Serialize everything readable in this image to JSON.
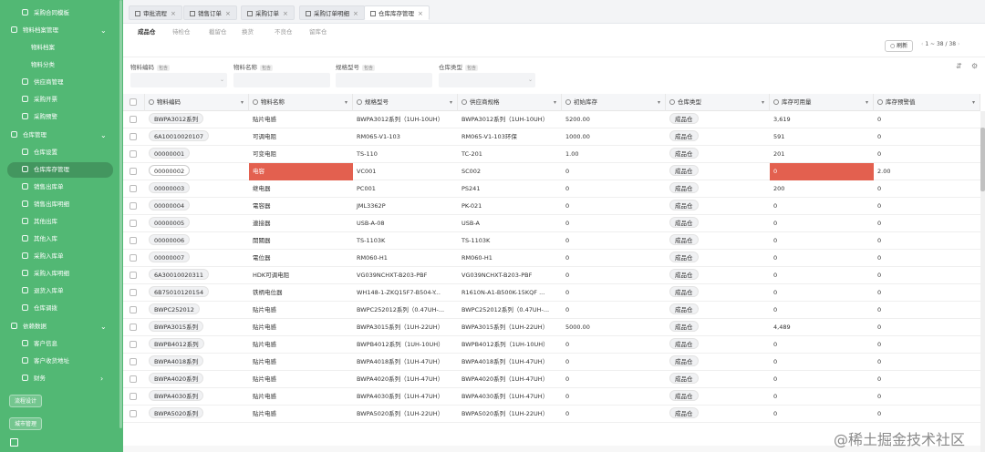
{
  "sidebar": {
    "items": [
      {
        "label": "采购合同模板",
        "level": 1,
        "chevron": false
      },
      {
        "label": "物料档案管理",
        "level": 0,
        "chevron": true
      },
      {
        "label": "物料档案",
        "level": 2,
        "chevron": false
      },
      {
        "label": "物料分类",
        "level": 2,
        "chevron": false
      },
      {
        "label": "供应商管理",
        "level": 1,
        "chevron": false
      },
      {
        "label": "采购开票",
        "level": 1,
        "chevron": false
      },
      {
        "label": "采购预警",
        "level": 1,
        "chevron": false
      },
      {
        "label": "仓库管理",
        "level": 0,
        "chevron": true
      },
      {
        "label": "仓库设置",
        "level": 1,
        "chevron": false
      },
      {
        "label": "仓库库存管理",
        "level": 1,
        "chevron": false,
        "active": true
      },
      {
        "label": "销售出库单",
        "level": 1,
        "chevron": false
      },
      {
        "label": "销售出库明细",
        "level": 1,
        "chevron": false
      },
      {
        "label": "其他出库",
        "level": 1,
        "chevron": false
      },
      {
        "label": "其他入库",
        "level": 1,
        "chevron": false
      },
      {
        "label": "采购入库单",
        "level": 1,
        "chevron": false
      },
      {
        "label": "采购入库明细",
        "level": 1,
        "chevron": false
      },
      {
        "label": "退货入库单",
        "level": 1,
        "chevron": false
      },
      {
        "label": "仓库调拨",
        "level": 1,
        "chevron": false
      },
      {
        "label": "依赖数据",
        "level": 0,
        "chevron": true
      },
      {
        "label": "客户信息",
        "level": 1,
        "chevron": false
      },
      {
        "label": "客户收货地址",
        "level": 1,
        "chevron": false
      },
      {
        "label": "财务",
        "level": 1,
        "chevron": "right"
      }
    ],
    "buttons": [
      "流程设计",
      "城市管理"
    ]
  },
  "tabs": [
    {
      "label": "审批流程",
      "active": false
    },
    {
      "label": "销售订单",
      "active": false
    },
    {
      "label": "采购订单",
      "active": false
    },
    {
      "label": "采购订单明细",
      "active": false
    },
    {
      "label": "仓库库存管理",
      "active": true
    }
  ],
  "subtabs": [
    "成品仓",
    "待检仓",
    "截留仓",
    "换货",
    "不良仓",
    "留库仓"
  ],
  "toolbar": {
    "refresh_label": "刷新",
    "pager": "1 ~ 38 / 38"
  },
  "filters": [
    {
      "label": "物料编码",
      "tag": "包含"
    },
    {
      "label": "物料名称",
      "tag": "包含"
    },
    {
      "label": "规格型号",
      "tag": "包含"
    },
    {
      "label": "仓库类型",
      "tag": "包含"
    }
  ],
  "table": {
    "columns": [
      "物料编码",
      "物料名称",
      "规格型号",
      "供应商规格",
      "初始库存",
      "仓库类型",
      "库存可用量",
      "库存预警值"
    ],
    "rows": [
      {
        "code": "BWPA3012系列",
        "name": "贴片电感",
        "spec": "BWPA3012系列（1UH-10UH）",
        "supplier_spec": "BWPA3012系列（1UH-10UH）",
        "init": "5200.00",
        "wh": "成品仓",
        "avail": "3,619",
        "warn": "0"
      },
      {
        "code": "6A10010020107",
        "name": "可调电阻",
        "spec": "RM065-V1-103",
        "supplier_spec": "RM065-V1-103环保",
        "init": "1000.00",
        "wh": "成品仓",
        "avail": "591",
        "warn": "0"
      },
      {
        "code": "00000001",
        "name": "可变电阻",
        "spec": "TS-110",
        "supplier_spec": "TC-201",
        "init": "1.00",
        "wh": "成品仓",
        "avail": "201",
        "warn": "0"
      },
      {
        "code": "00000002",
        "name": "电容",
        "spec": "VC001",
        "supplier_spec": "SC002",
        "init": "0",
        "wh": "成品仓",
        "avail": "0",
        "warn": "2.00",
        "highlight": true
      },
      {
        "code": "00000003",
        "name": "继电器",
        "spec": "PC001",
        "supplier_spec": "PS241",
        "init": "0",
        "wh": "成品仓",
        "avail": "200",
        "warn": "0"
      },
      {
        "code": "00000004",
        "name": "電容器",
        "spec": "JML3362P",
        "supplier_spec": "PK-021",
        "init": "0",
        "wh": "成品仓",
        "avail": "0",
        "warn": "0"
      },
      {
        "code": "00000005",
        "name": "連接器",
        "spec": "USB-A-08",
        "supplier_spec": "USB-A",
        "init": "0",
        "wh": "成品仓",
        "avail": "0",
        "warn": "0"
      },
      {
        "code": "00000006",
        "name": "開關器",
        "spec": "TS-1103K",
        "supplier_spec": "TS-1103K",
        "init": "0",
        "wh": "成品仓",
        "avail": "0",
        "warn": "0"
      },
      {
        "code": "00000007",
        "name": "電位器",
        "spec": "RM060-H1",
        "supplier_spec": "RM060-H1",
        "init": "0",
        "wh": "成品仓",
        "avail": "0",
        "warn": "0"
      },
      {
        "code": "6A30010020311",
        "name": "HDK可调电阻",
        "spec": "VG039NCHXT-B203-PBF",
        "supplier_spec": "VG039NCHXT-B203-PBF",
        "init": "0",
        "wh": "成品仓",
        "avail": "0",
        "warn": "0"
      },
      {
        "code": "6B75010120154",
        "name": "铁柄电位器",
        "spec": "WH148-1-ZKQ15F7-B504-Y...",
        "supplier_spec": "R1610N-A1-B500K-15KQF ...",
        "init": "0",
        "wh": "成品仓",
        "avail": "0",
        "warn": "0"
      },
      {
        "code": "BWPC252012",
        "name": "贴片电感",
        "spec": "BWPC252012系列（0.47UH-...",
        "supplier_spec": "BWPC252012系列（0.47UH-...",
        "init": "0",
        "wh": "成品仓",
        "avail": "0",
        "warn": "0"
      },
      {
        "code": "BWPA3015系列",
        "name": "贴片电感",
        "spec": "BWPA3015系列（1UH-22UH）",
        "supplier_spec": "BWPA3015系列（1UH-22UH）",
        "init": "5000.00",
        "wh": "成品仓",
        "avail": "4,489",
        "warn": "0"
      },
      {
        "code": "BWPB4012系列",
        "name": "贴片电感",
        "spec": "BWPB4012系列（1UH-10UH）",
        "supplier_spec": "BWPB4012系列（1UH-10UH）",
        "init": "0",
        "wh": "成品仓",
        "avail": "0",
        "warn": "0"
      },
      {
        "code": "BWPA4018系列",
        "name": "贴片电感",
        "spec": "BWPA4018系列（1UH-47UH）",
        "supplier_spec": "BWPA4018系列（1UH-47UH）",
        "init": "0",
        "wh": "成品仓",
        "avail": "0",
        "warn": "0"
      },
      {
        "code": "BWPA4020系列",
        "name": "贴片电感",
        "spec": "BWPA4020系列（1UH-47UH）",
        "supplier_spec": "BWPA4020系列（1UH-47UH）",
        "init": "0",
        "wh": "成品仓",
        "avail": "0",
        "warn": "0"
      },
      {
        "code": "BWPA4030系列",
        "name": "贴片电感",
        "spec": "BWPA4030系列（1UH-47UH）",
        "supplier_spec": "BWPA4030系列（1UH-47UH）",
        "init": "0",
        "wh": "成品仓",
        "avail": "0",
        "warn": "0"
      },
      {
        "code": "BWPA5020系列",
        "name": "贴片电感",
        "spec": "BWPA5020系列（1UH-22UH）",
        "supplier_spec": "BWPA5020系列（1UH-22UH）",
        "init": "0",
        "wh": "成品仓",
        "avail": "0",
        "warn": "0"
      }
    ]
  },
  "watermark": "@稀土掘金技术社区",
  "colors": {
    "sidebar": "#52b874",
    "highlight": "#e3604f"
  },
  "icons": {
    "tab": "grid-icon",
    "close": "close-icon",
    "refresh": "refresh-icon",
    "link": "external-link-icon"
  }
}
